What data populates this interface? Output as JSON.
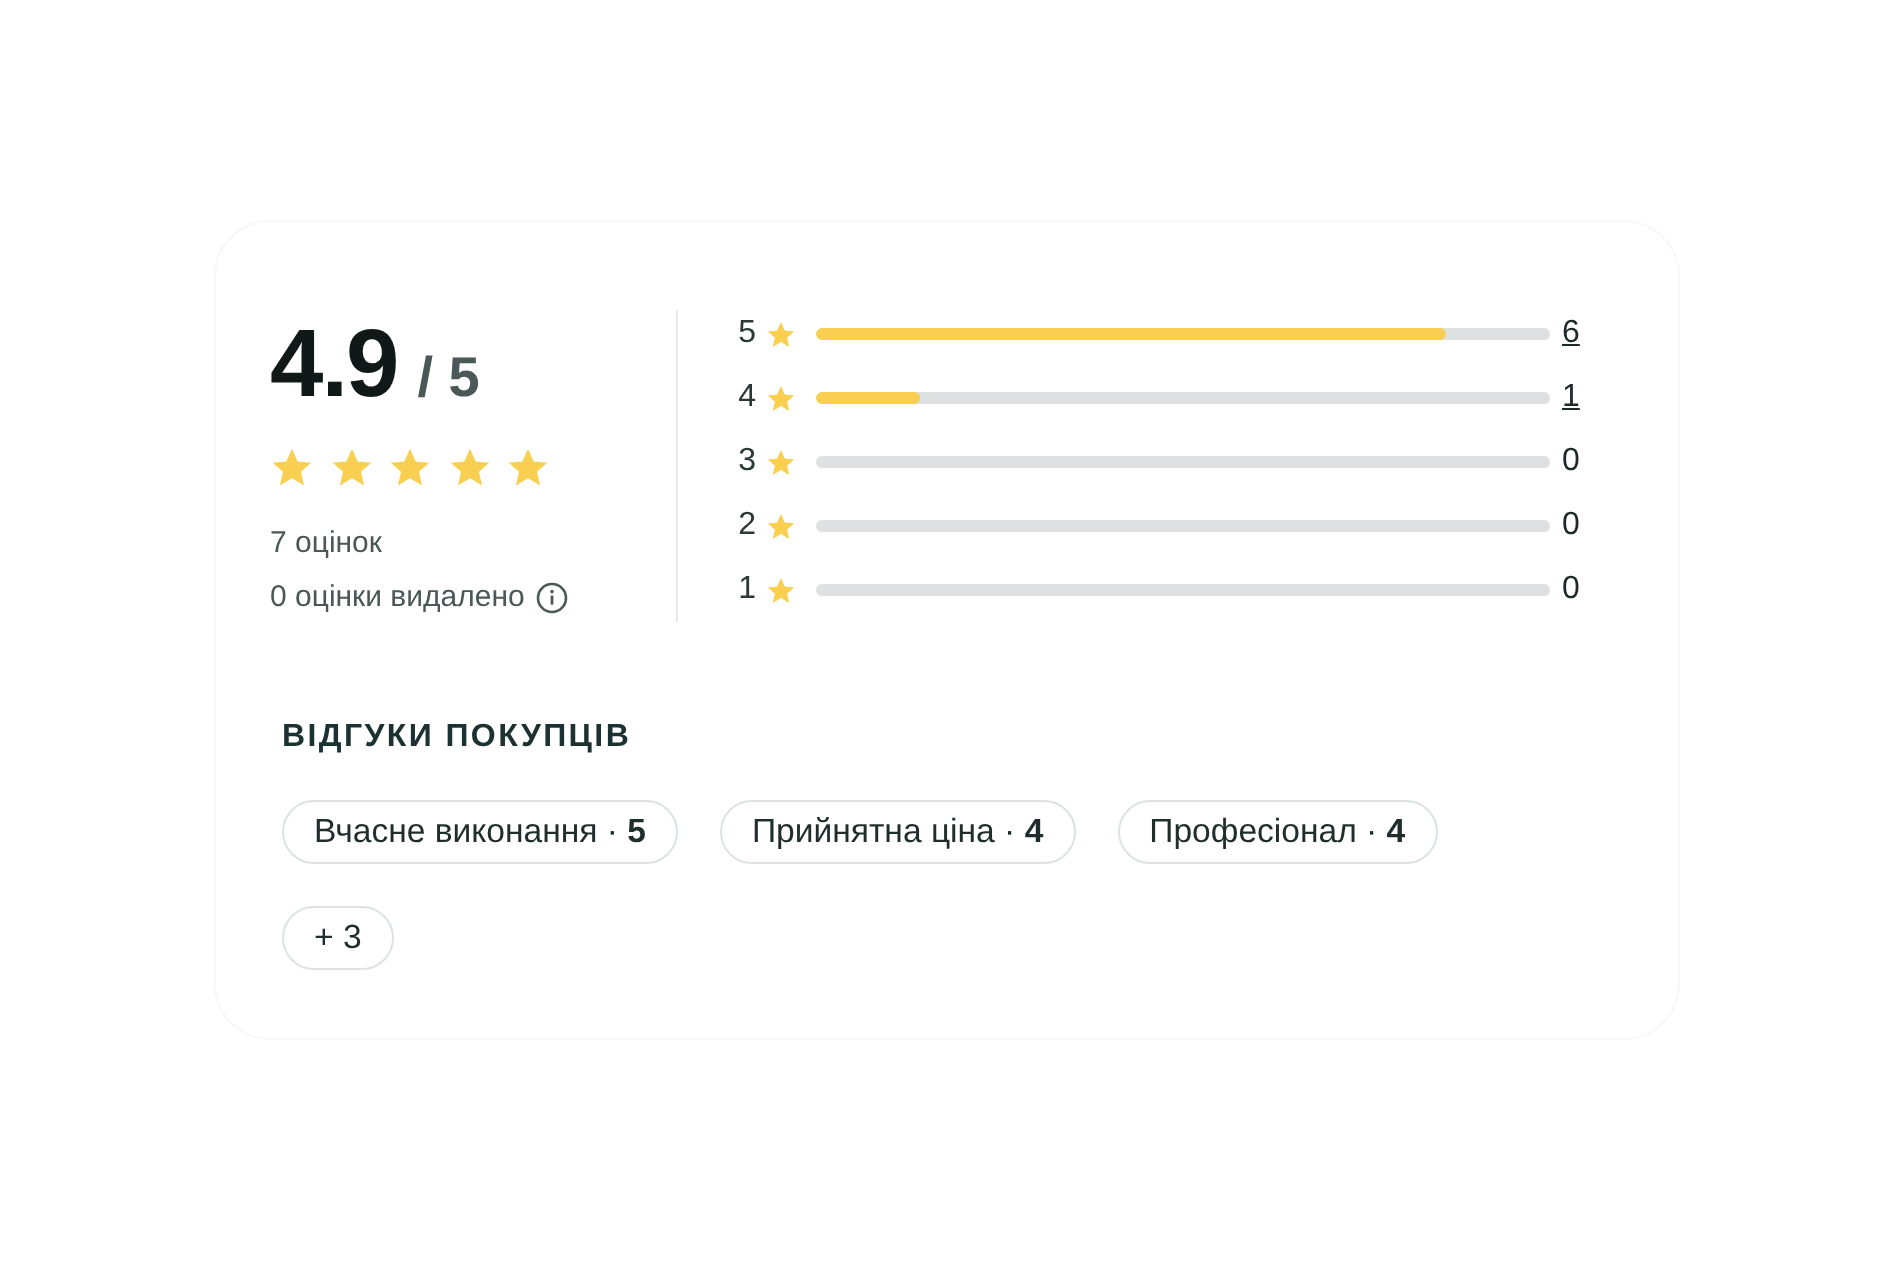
{
  "summary": {
    "score": "4.9",
    "scale": "/ 5",
    "stars": 5,
    "ratings_count": "7 оцінок",
    "removed_note": "0 оцінки видалено"
  },
  "distribution": [
    {
      "label": "5",
      "level": 0.857,
      "count": "6",
      "linked": true
    },
    {
      "label": "4",
      "level": 0.143,
      "count": "1",
      "linked": true
    },
    {
      "label": "3",
      "count": "0",
      "linked": false
    },
    {
      "label": "2",
      "count": "0",
      "linked": false
    },
    {
      "label": "1",
      "count": "0",
      "linked": false
    }
  ],
  "reviews": {
    "title": "ВІДГУКИ ПОКУПЦІВ",
    "tags": [
      {
        "text": "Вчасне виконання · **5**"
      },
      {
        "text": "Прийнятна ціна · **4**"
      },
      {
        "text": "Професіонал · **4**"
      },
      {
        "text": "+ 3"
      }
    ]
  }
}
